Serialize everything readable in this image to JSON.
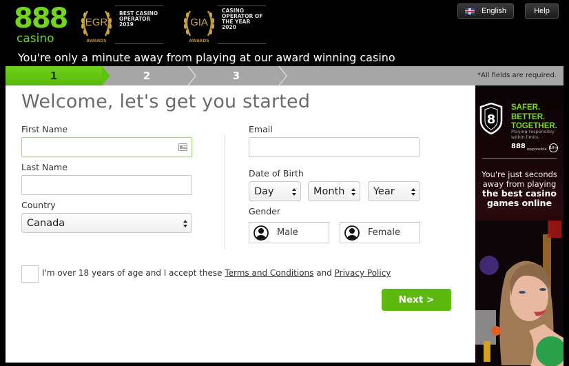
{
  "brand": {
    "logo_number": "888",
    "logo_word": "casino",
    "accent_color": "#6fd61c"
  },
  "awards": [
    {
      "badge": "EGR",
      "sub": "AWARDS",
      "text": "BEST CASINO OPERATOR 2019"
    },
    {
      "badge": "GIA",
      "sub": "AWARDS",
      "text": "CASINO OPERATOR OF THE YEAR 2020"
    }
  ],
  "header": {
    "language_label": "English",
    "help_label": "Help"
  },
  "tagline": "You're only a minute away from playing at our award winning casino",
  "steps": {
    "items": [
      "1",
      "2",
      "3"
    ],
    "active": "1",
    "required_note": "*All fields are required."
  },
  "form": {
    "title": "Welcome, let's get you started",
    "first_name": {
      "label": "First Name",
      "value": ""
    },
    "last_name": {
      "label": "Last Name",
      "value": ""
    },
    "country": {
      "label": "Country",
      "value": "Canada"
    },
    "email": {
      "label": "Email",
      "value": ""
    },
    "dob": {
      "label": "Date of Birth",
      "day": "Day",
      "month": "Month",
      "year": "Year"
    },
    "gender": {
      "label": "Gender",
      "male": "Male",
      "female": "Female"
    },
    "terms": {
      "prefix": "I'm over 18 years of age and I accept these ",
      "terms_link": "Terms and Conditions",
      "middle": " and ",
      "privacy_link": "Privacy Policy",
      "checked": false
    },
    "next_label": "Next >"
  },
  "banner": {
    "slogan_lines": [
      "SAFER.",
      "BETTER.",
      "TOGETHER."
    ],
    "slogan_sub": "Playing responsibly within limits.",
    "brand": "888",
    "brand_suffix": "responsible",
    "age_badge": "18+",
    "promo_line1": "You're just seconds away from playing",
    "promo_line2": "the best casino games online"
  }
}
